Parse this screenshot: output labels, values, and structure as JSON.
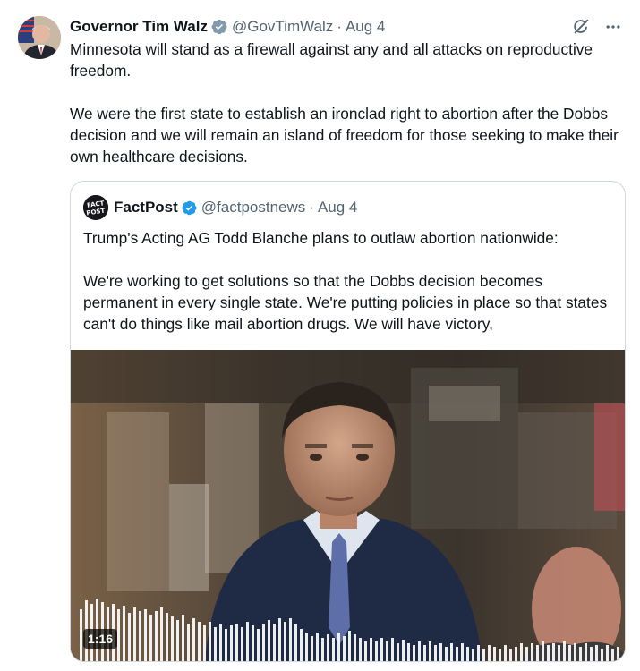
{
  "author": {
    "name": "Governor Tim Walz",
    "handle": "@GovTimWalz",
    "separator": "·",
    "date": "Aug 4",
    "verified_badge": "gray-verified-badge-icon"
  },
  "post": {
    "paragraphs": [
      "Minnesota will stand as a firewall against any and all attacks on reproductive freedom.",
      "We were the first state to establish an ironclad right to abortion after the Dobbs decision and we will remain an island of freedom for those seeking to make their own healthcare decisions."
    ]
  },
  "actions": {
    "grok_icon": "grok-icon",
    "more_icon": "more-horizontal-icon"
  },
  "quoted_post": {
    "author_name": "FactPost",
    "handle": "@factpostnews",
    "separator": "·",
    "date": "Aug 4",
    "avatar_label": "FACT POST",
    "verified_badge": "blue-verified-badge-icon",
    "paragraphs": [
      "Trump's Acting AG Todd Blanche plans to outlaw abortion nationwide:",
      "We're working to get solutions so that the Dobbs decision becomes permanent in every single state. We're putting policies in place so that states can't do things like mail abortion drugs. We will have victory,"
    ],
    "media": {
      "type": "video",
      "duration": "1:16"
    }
  },
  "colors": {
    "text_primary": "#0f1419",
    "text_secondary": "#536471",
    "border": "#cfd9de",
    "verified_blue": "#1d9bf0",
    "verified_gray": "#829aab"
  }
}
